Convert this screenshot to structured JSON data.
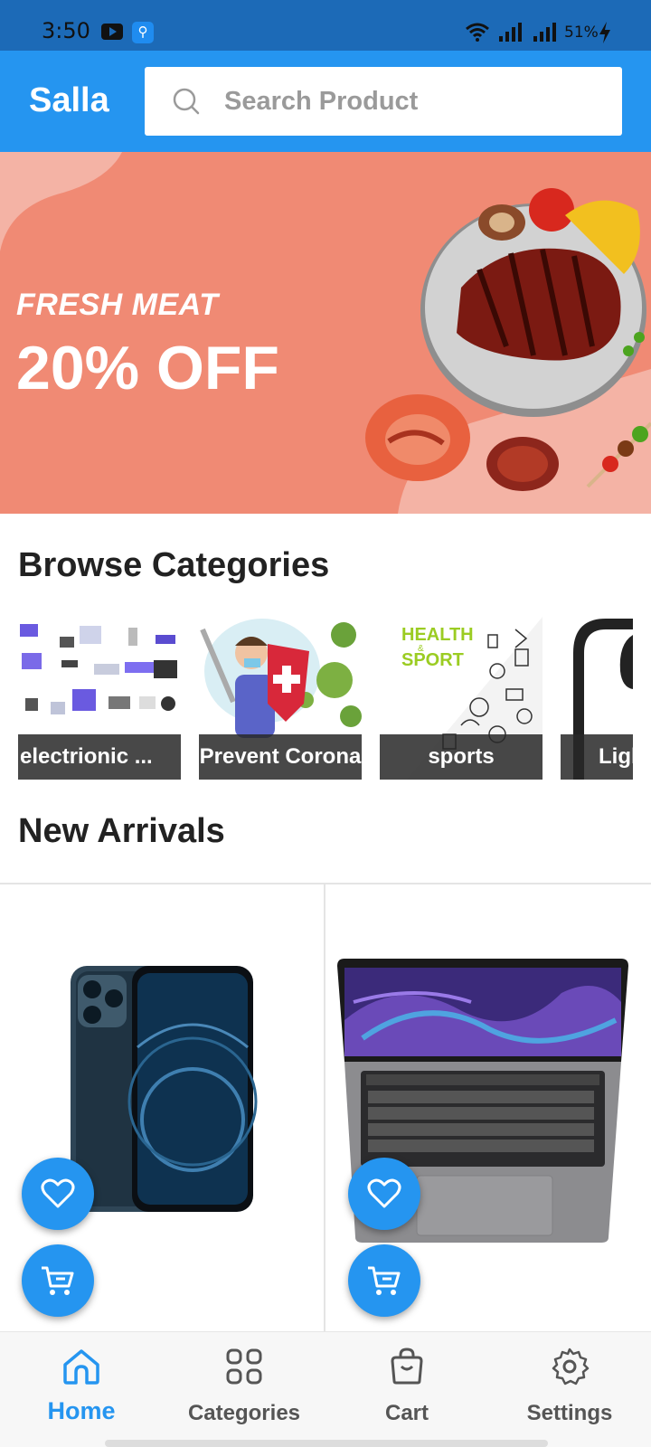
{
  "status_bar": {
    "time": "3:50",
    "battery": "51%"
  },
  "app_bar": {
    "brand": "Salla",
    "search_placeholder": "Search Product"
  },
  "banner": {
    "tagline": "FRESH MEAT",
    "headline": "20% OFF"
  },
  "sections": {
    "browse_title": "Browse Categories",
    "arrivals_title": "New Arrivals"
  },
  "categories": [
    {
      "label": "electrionic ..."
    },
    {
      "label": "Prevent Corona"
    },
    {
      "label": "sports"
    },
    {
      "label": "Ligh"
    }
  ],
  "category_art": {
    "sports_logo_top": "HEALTH",
    "sports_logo_mid": "&",
    "sports_logo_bottom": "SPORT"
  },
  "products": [
    {
      "image": "iphone-product-image"
    },
    {
      "image": "macbook-product-image"
    }
  ],
  "bottom_nav": {
    "home": "Home",
    "categories": "Categories",
    "cart": "Cart",
    "settings": "Settings"
  },
  "colors": {
    "primary": "#2595f0",
    "status_bar": "#1c6ab7",
    "banner": "#f08a74"
  }
}
